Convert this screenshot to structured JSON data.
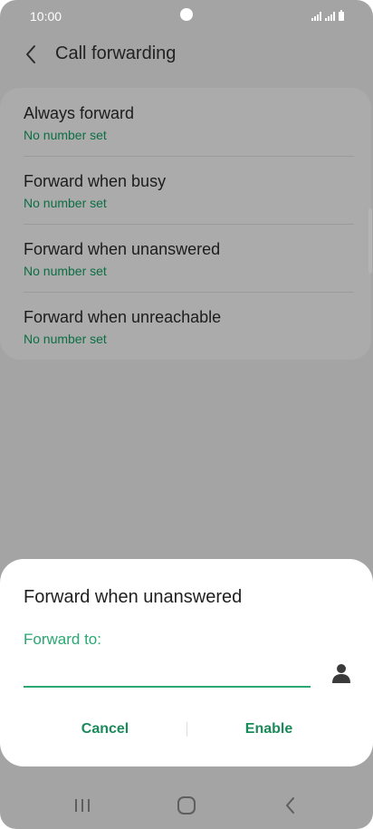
{
  "status_bar": {
    "time": "10:00",
    "icons": [
      "signal-icon",
      "signal-icon",
      "battery-icon"
    ]
  },
  "header": {
    "back_icon": "chevron-left-icon",
    "title": "Call forwarding"
  },
  "forwarding_options": [
    {
      "title": "Always forward",
      "subtitle": "No number set"
    },
    {
      "title": "Forward when busy",
      "subtitle": "No number set"
    },
    {
      "title": "Forward when unanswered",
      "subtitle": "No number set"
    },
    {
      "title": "Forward when unreachable",
      "subtitle": "No number set"
    }
  ],
  "dialog": {
    "title": "Forward when unanswered",
    "field_label": "Forward to:",
    "field_value": "",
    "contact_icon": "person-icon",
    "cancel_label": "Cancel",
    "enable_label": "Enable"
  },
  "nav_bar": {
    "icons": [
      "recents-icon",
      "home-icon",
      "back-icon"
    ]
  },
  "colors": {
    "accent": "#2aa772",
    "accent_dark": "#1b8a5a",
    "subtitle": "#0c6e45",
    "scrim": "#a4a4a4"
  }
}
